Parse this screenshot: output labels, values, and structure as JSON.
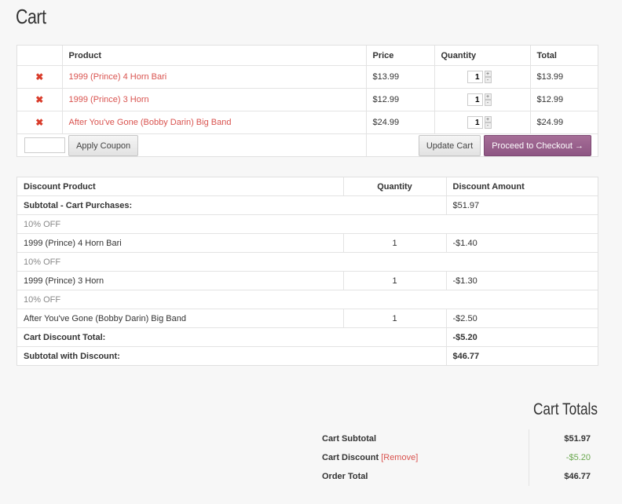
{
  "page": {
    "title": "Cart"
  },
  "cart": {
    "headers": {
      "product": "Product",
      "price": "Price",
      "quantity": "Quantity",
      "total": "Total"
    },
    "remove_glyph": "✖",
    "items": [
      {
        "product": "1999 (Prince) 4 Horn Bari",
        "price": "$13.99",
        "qty": "1",
        "total": "$13.99"
      },
      {
        "product": "1999 (Prince) 3 Horn",
        "price": "$12.99",
        "qty": "1",
        "total": "$12.99"
      },
      {
        "product": "After You've Gone (Bobby Darin) Big Band",
        "price": "$24.99",
        "qty": "1",
        "total": "$24.99"
      }
    ],
    "coupon_value": "",
    "apply_coupon_label": "Apply Coupon",
    "update_cart_label": "Update Cart",
    "checkout_label": "Proceed to Checkout →",
    "spin_up": "+",
    "spin_down": "-"
  },
  "discount": {
    "headers": {
      "product": "Discount Product",
      "quantity": "Quantity",
      "amount": "Discount Amount"
    },
    "subtotal_label": "Subtotal - Cart Purchases:",
    "subtotal_value": "$51.97",
    "rows": [
      {
        "offer": "10% OFF",
        "product": "1999 (Prince) 4 Horn Bari",
        "qty": "1",
        "amount": "-$1.40"
      },
      {
        "offer": "10% OFF",
        "product": "1999 (Prince) 3 Horn",
        "qty": "1",
        "amount": "-$1.30"
      },
      {
        "offer": "10% OFF",
        "product": "After You've Gone (Bobby Darin) Big Band",
        "qty": "1",
        "amount": "-$2.50"
      }
    ],
    "total_label": "Cart Discount Total:",
    "total_value": "-$5.20",
    "with_discount_label": "Subtotal with Discount:",
    "with_discount_value": "$46.77"
  },
  "totals": {
    "title": "Cart Totals",
    "subtotal_label": "Cart Subtotal",
    "subtotal_value": "$51.97",
    "discount_label": "Cart Discount",
    "remove_label": "[Remove]",
    "discount_value": "-$5.20",
    "order_total_label": "Order Total",
    "order_total_value": "$46.77"
  },
  "colors": {
    "accent": "#d9534f",
    "checkout": "#9a6190",
    "discount_green": "#6aa84f"
  }
}
